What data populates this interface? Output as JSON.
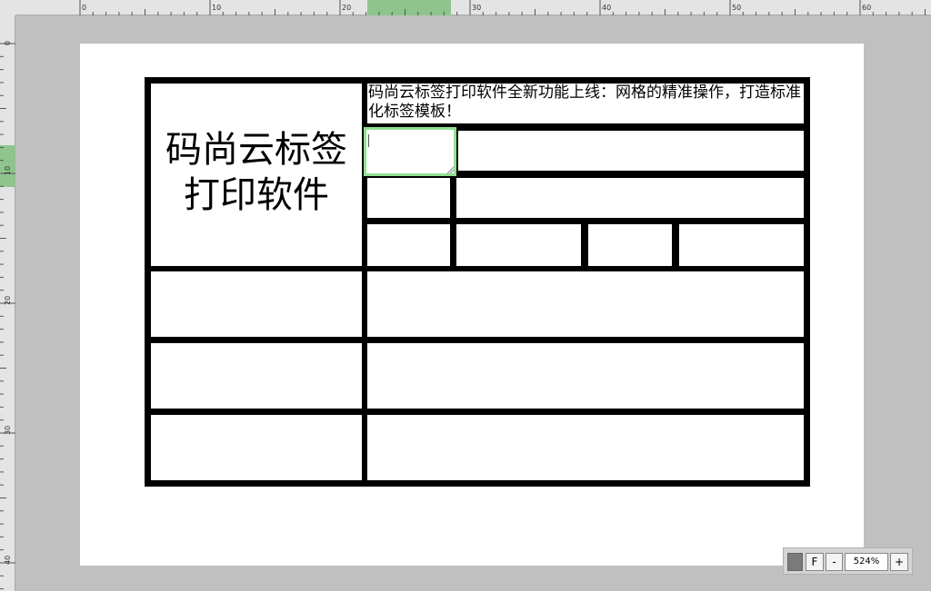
{
  "ruler": {
    "top_labels": [
      "0",
      "10",
      "20",
      "30",
      "40",
      "50",
      "60"
    ],
    "left_labels": [
      "0",
      "10",
      "20",
      "30",
      "40"
    ]
  },
  "label": {
    "brand_title": "码尚云标签打印软件",
    "header_text": "码尚云标签打印软件全新功能上线：网格的精准操作，打造标准化标签模板！"
  },
  "zoom": {
    "fit_label": "F",
    "minus_label": "-",
    "value": "524%",
    "plus_label": "+"
  },
  "colors": {
    "selection": "#90e090",
    "ruler_highlight": "#8fc48f",
    "workspace": "#c0c0c0"
  }
}
